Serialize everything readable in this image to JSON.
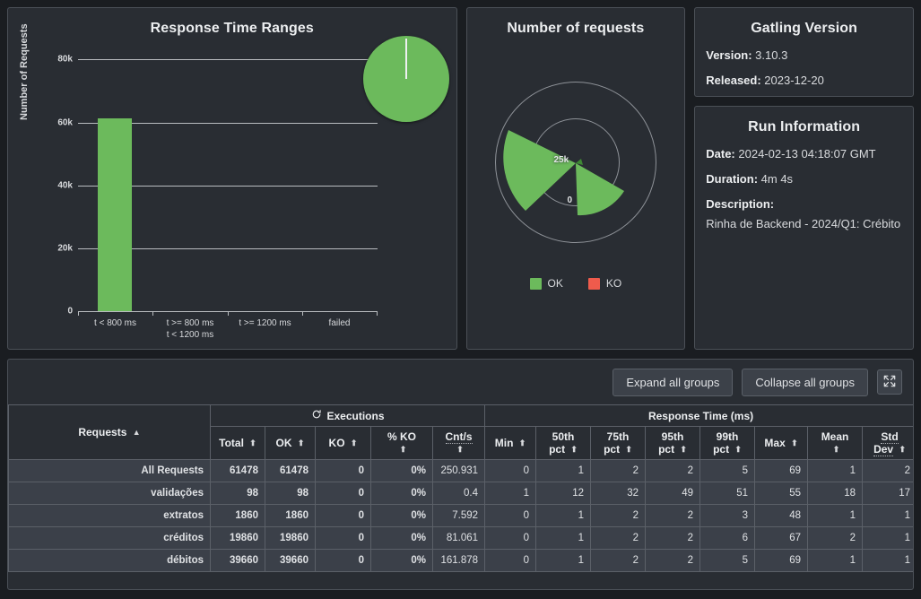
{
  "charts": {
    "response_time_ranges": {
      "title": "Response Time Ranges",
      "ylabel": "Number of Requests",
      "yticks": [
        "80k",
        "60k",
        "40k",
        "20k",
        "0"
      ],
      "categories": [
        "t < 800 ms",
        "t >= 800 ms\nt < 1200 ms",
        "t >= 1200 ms",
        "failed"
      ],
      "cat_line1": [
        "t < 800 ms",
        "t >= 800 ms",
        "t >= 1200 ms",
        "failed"
      ],
      "cat_line2": [
        "",
        "t < 1200 ms",
        "",
        ""
      ]
    },
    "number_of_requests": {
      "title": "Number of requests",
      "ring_labels": [
        "25k",
        "0"
      ],
      "legend": [
        {
          "label": "OK",
          "color": "#6cba5c"
        },
        {
          "label": "KO",
          "color": "#ef5b4c"
        }
      ]
    }
  },
  "gatling_version": {
    "title": "Gatling Version",
    "version_label": "Version:",
    "version_value": "3.10.3",
    "released_label": "Released:",
    "released_value": "2023-12-20"
  },
  "run_information": {
    "title": "Run Information",
    "date_label": "Date:",
    "date_value": "2024-02-13 04:18:07 GMT",
    "duration_label": "Duration:",
    "duration_value": "4m 4s",
    "description_label": "Description:",
    "description_value": "Rinha de Backend - 2024/Q1: Crébito"
  },
  "toolbar": {
    "expand_label": "Expand all groups",
    "collapse_label": "Collapse all groups",
    "fullscreen_icon": "expand-arrows-icon"
  },
  "table": {
    "group_headers": {
      "requests": "Requests",
      "executions": "Executions",
      "response_time": "Response Time (ms)"
    },
    "columns": [
      "Total",
      "OK",
      "KO",
      "% KO",
      "Cnt/s",
      "Min",
      "50th pct",
      "75th pct",
      "95th pct",
      "99th pct",
      "Max",
      "Mean",
      "Std Dev"
    ],
    "column_lines": [
      [
        "Total",
        ""
      ],
      [
        "OK",
        ""
      ],
      [
        "KO",
        ""
      ],
      [
        "%",
        "KO"
      ],
      [
        "Cnt/s",
        ""
      ],
      [
        "Min",
        ""
      ],
      [
        "50th",
        "pct"
      ],
      [
        "75th",
        "pct"
      ],
      [
        "95th",
        "pct"
      ],
      [
        "99th",
        "pct"
      ],
      [
        "Max",
        ""
      ],
      [
        "Mean",
        ""
      ],
      [
        "Std",
        "Dev"
      ]
    ],
    "sort_active_column": "Requests",
    "sort_direction": "asc",
    "rows": [
      {
        "name": "All Requests",
        "total": "61478",
        "ok": "61478",
        "ko": "0",
        "pct_ko": "0%",
        "cnt_s": "250.931",
        "min": "0",
        "p50": "1",
        "p75": "2",
        "p95": "2",
        "p99": "5",
        "max": "69",
        "mean": "1",
        "std_dev": "2"
      },
      {
        "name": "validações",
        "total": "98",
        "ok": "98",
        "ko": "0",
        "pct_ko": "0%",
        "cnt_s": "0.4",
        "min": "1",
        "p50": "12",
        "p75": "32",
        "p95": "49",
        "p99": "51",
        "max": "55",
        "mean": "18",
        "std_dev": "17"
      },
      {
        "name": "extratos",
        "total": "1860",
        "ok": "1860",
        "ko": "0",
        "pct_ko": "0%",
        "cnt_s": "7.592",
        "min": "0",
        "p50": "1",
        "p75": "2",
        "p95": "2",
        "p99": "3",
        "max": "48",
        "mean": "1",
        "std_dev": "1"
      },
      {
        "name": "créditos",
        "total": "19860",
        "ok": "19860",
        "ko": "0",
        "pct_ko": "0%",
        "cnt_s": "81.061",
        "min": "0",
        "p50": "1",
        "p75": "2",
        "p95": "2",
        "p99": "6",
        "max": "67",
        "mean": "2",
        "std_dev": "1"
      },
      {
        "name": "débitos",
        "total": "39660",
        "ok": "39660",
        "ko": "0",
        "pct_ko": "0%",
        "cnt_s": "161.878",
        "min": "0",
        "p50": "1",
        "p75": "2",
        "p95": "2",
        "p99": "5",
        "max": "69",
        "mean": "1",
        "std_dev": "1"
      }
    ]
  },
  "colors": {
    "ok_green": "#6cba5c",
    "ko_red": "#ef5b4c",
    "total_orange": "#ffa800",
    "panel_bg": "#292d33",
    "page_bg": "#1a1d21",
    "row_bg": "#3b4049"
  },
  "chart_data": [
    {
      "type": "bar",
      "title": "Response Time Ranges",
      "xlabel": "",
      "ylabel": "Number of Requests",
      "categories": [
        "t < 800 ms",
        "t >= 800 ms / t < 1200 ms",
        "t >= 1200 ms",
        "failed"
      ],
      "values": [
        61478,
        0,
        0,
        0
      ],
      "ylim": [
        0,
        90000
      ],
      "yticks": [
        0,
        20000,
        40000,
        60000,
        80000
      ],
      "ytick_labels": [
        "0",
        "20k",
        "40k",
        "60k",
        "80k"
      ],
      "grid": true,
      "legend": "none",
      "series_color": "#6cba5c",
      "inset_pie": {
        "type": "pie",
        "slices": [
          {
            "label": "t < 800 ms",
            "value": 61478,
            "color": "#6cba5c"
          }
        ]
      }
    },
    {
      "type": "pie",
      "title": "Number of requests",
      "subtype": "polar-area",
      "radial_axis_labels": [
        "0",
        "25k"
      ],
      "radial_ticks": [
        0,
        25000,
        50000
      ],
      "legend": [
        "OK",
        "KO"
      ],
      "legend_position": "bottom",
      "legend_colors": [
        "#6cba5c",
        "#ef5b4c"
      ],
      "slices": [
        {
          "label": "débitos",
          "value": 39660,
          "color": "#6cba5c"
        },
        {
          "label": "créditos",
          "value": 19860,
          "color": "#6cba5c"
        },
        {
          "label": "extratos",
          "value": 1860,
          "color": "#6cba5c"
        },
        {
          "label": "validações",
          "value": 98,
          "color": "#6cba5c"
        }
      ]
    },
    {
      "type": "table",
      "title": "Requests statistics",
      "columns": [
        "Requests",
        "Total",
        "OK",
        "KO",
        "% KO",
        "Cnt/s",
        "Min",
        "50th pct",
        "75th pct",
        "95th pct",
        "99th pct",
        "Max",
        "Mean",
        "Std Dev"
      ],
      "rows": [
        [
          "All Requests",
          61478,
          61478,
          0,
          "0%",
          250.931,
          0,
          1,
          2,
          2,
          5,
          69,
          1,
          2
        ],
        [
          "validações",
          98,
          98,
          0,
          "0%",
          0.4,
          1,
          12,
          32,
          49,
          51,
          55,
          18,
          17
        ],
        [
          "extratos",
          1860,
          1860,
          0,
          "0%",
          7.592,
          0,
          1,
          2,
          2,
          3,
          48,
          1,
          1
        ],
        [
          "créditos",
          19860,
          19860,
          0,
          "0%",
          81.061,
          0,
          1,
          2,
          2,
          6,
          67,
          2,
          1
        ],
        [
          "débitos",
          39660,
          39660,
          0,
          "0%",
          161.878,
          0,
          1,
          2,
          2,
          5,
          69,
          1,
          1
        ]
      ]
    }
  ]
}
